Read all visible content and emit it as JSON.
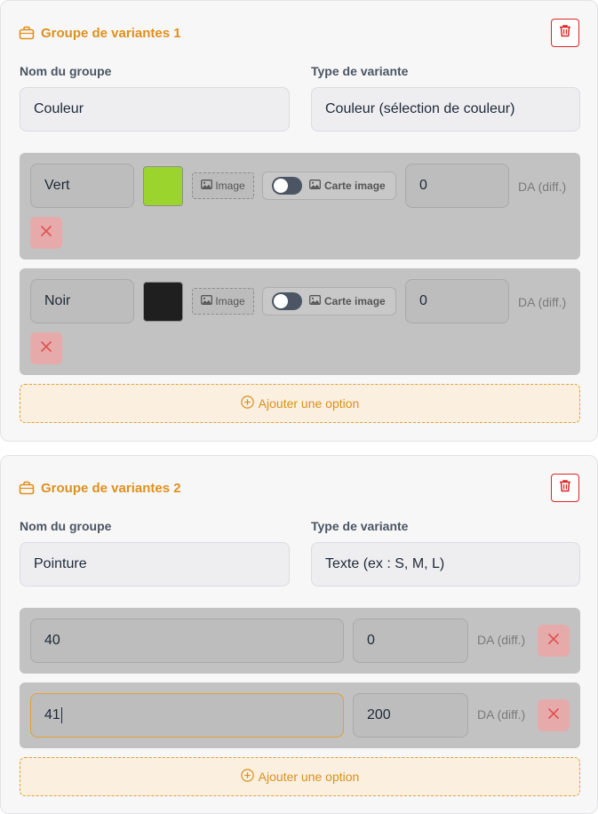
{
  "groups": [
    {
      "title": "Groupe de variantes 1",
      "name_label": "Nom du groupe",
      "name_value": "Couleur",
      "type_label": "Type de variante",
      "type_value": "Couleur (sélection de couleur)",
      "options": [
        {
          "name": "Vert",
          "swatch_color": "#9bd42d",
          "image_label": "Image",
          "carte_label": "Carte image",
          "price": "0",
          "unit": "DA (diff.)"
        },
        {
          "name": "Noir",
          "swatch_color": "#1f1f1f",
          "image_label": "Image",
          "carte_label": "Carte image",
          "price": "0",
          "unit": "DA (diff.)"
        }
      ],
      "add_label": "Ajouter une option"
    },
    {
      "title": "Groupe de variantes 2",
      "name_label": "Nom du groupe",
      "name_value": "Pointure",
      "type_label": "Type de variante",
      "type_value": "Texte (ex : S, M, L)",
      "options": [
        {
          "name": "40",
          "price": "0",
          "unit": "DA (diff.)"
        },
        {
          "name": "41",
          "price": "200",
          "unit": "DA (diff.)"
        }
      ],
      "add_label": "Ajouter une option"
    }
  ],
  "colors": {
    "accent": "#e0901b",
    "danger": "#dc2626"
  }
}
